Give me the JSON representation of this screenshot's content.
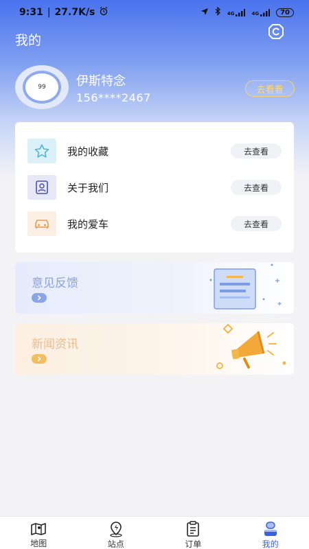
{
  "status_bar": {
    "time": "9:31",
    "speed": "27.7K/s",
    "network_1": "4G",
    "network_2": "4G",
    "battery": "70"
  },
  "header": {
    "title": "我的",
    "settings_icon": "settings-gear-icon"
  },
  "profile": {
    "avatar_value": "99",
    "name": "伊斯特念",
    "phone": "156****2467",
    "action_label": "去看看"
  },
  "menu": {
    "items": [
      {
        "label": "我的收藏",
        "button": "去查看",
        "icon": "star-icon",
        "icon_bg": "#dcf1f7",
        "icon_color": "#4cb7cf"
      },
      {
        "label": "关于我们",
        "button": "去查看",
        "icon": "user-card-icon",
        "icon_bg": "#e6e8f8",
        "icon_color": "#4b50a8"
      },
      {
        "label": "我的爱车",
        "button": "去查看",
        "icon": "car-icon",
        "icon_bg": "#fbeee2",
        "icon_color": "#e39a53"
      }
    ]
  },
  "banners": {
    "feedback": {
      "title": "意见反馈",
      "icon": "arrow-right-icon"
    },
    "news": {
      "title": "新闻资讯",
      "icon": "arrow-right-icon"
    }
  },
  "bottom_nav": {
    "items": [
      {
        "label": "地图",
        "icon": "map-icon"
      },
      {
        "label": "站点",
        "icon": "station-pin-icon"
      },
      {
        "label": "订单",
        "icon": "order-clipboard-icon"
      },
      {
        "label": "我的",
        "icon": "profile-icon"
      }
    ],
    "active_index": 3
  },
  "colors": {
    "primary": "#4a73ee",
    "accent_gold": "#f0d27a",
    "nav_active": "#3a5fd8"
  }
}
